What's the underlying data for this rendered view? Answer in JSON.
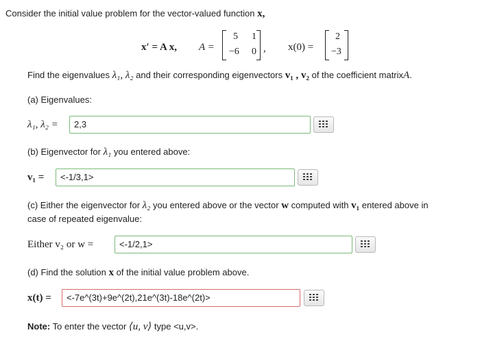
{
  "intro": {
    "text": "Consider the initial value problem for the vector-valued function",
    "var": "x,"
  },
  "equation": {
    "lhs": "x′ = A x,",
    "a_label": "A =",
    "matrix_a": [
      "5",
      "1",
      "−6",
      "0"
    ],
    "x0_label": "x(0) =",
    "x0": [
      "2",
      "−3"
    ]
  },
  "find": {
    "prefix": "Find the eigenvalues",
    "eigs": "λ₁, λ₂",
    "middle": "and their corresponding eigenvectors",
    "vecs": "v₁ , v₂",
    "suffix": "of the coefficient matrix",
    "matrix": "A",
    "dot": "."
  },
  "part_a": {
    "heading": "(a) Eigenvalues:",
    "label": "λ₁, λ₂ =",
    "value": "2,3"
  },
  "part_b": {
    "heading_pre": "(b) Eigenvector for",
    "heading_sym": "λ₁",
    "heading_post": "you entered above:",
    "label": "v₁ =",
    "value": "<-1/3,1>"
  },
  "part_c": {
    "line1_pre": "(c) Either the eigenvector for",
    "line1_sym": "λ₂",
    "line1_mid": "you entered above or the vector",
    "line1_w": "w",
    "line1_mid2": "computed with",
    "line1_v": "v₁",
    "line1_post": "entered above in",
    "line2": "case of repeated eigenvalue:",
    "label": "Either v₂ or w =",
    "value": "<-1/2,1>"
  },
  "part_d": {
    "heading_pre": "(d) Find the solution",
    "heading_sym": "x",
    "heading_post": "of the initial value problem above.",
    "label": "x(t) =",
    "value": "<-7e^(3t)+9e^(2t),21e^(3t)-18e^(2t)>"
  },
  "note": {
    "bold": "Note:",
    "pre": "To enter the vector",
    "sym": "⟨u, v⟩",
    "post": "type <u,v>."
  },
  "icons": {
    "keypad": "keypad-icon"
  },
  "colors": {
    "correct_border": "#7ab97a",
    "incorrect_border": "#d76b6b"
  }
}
